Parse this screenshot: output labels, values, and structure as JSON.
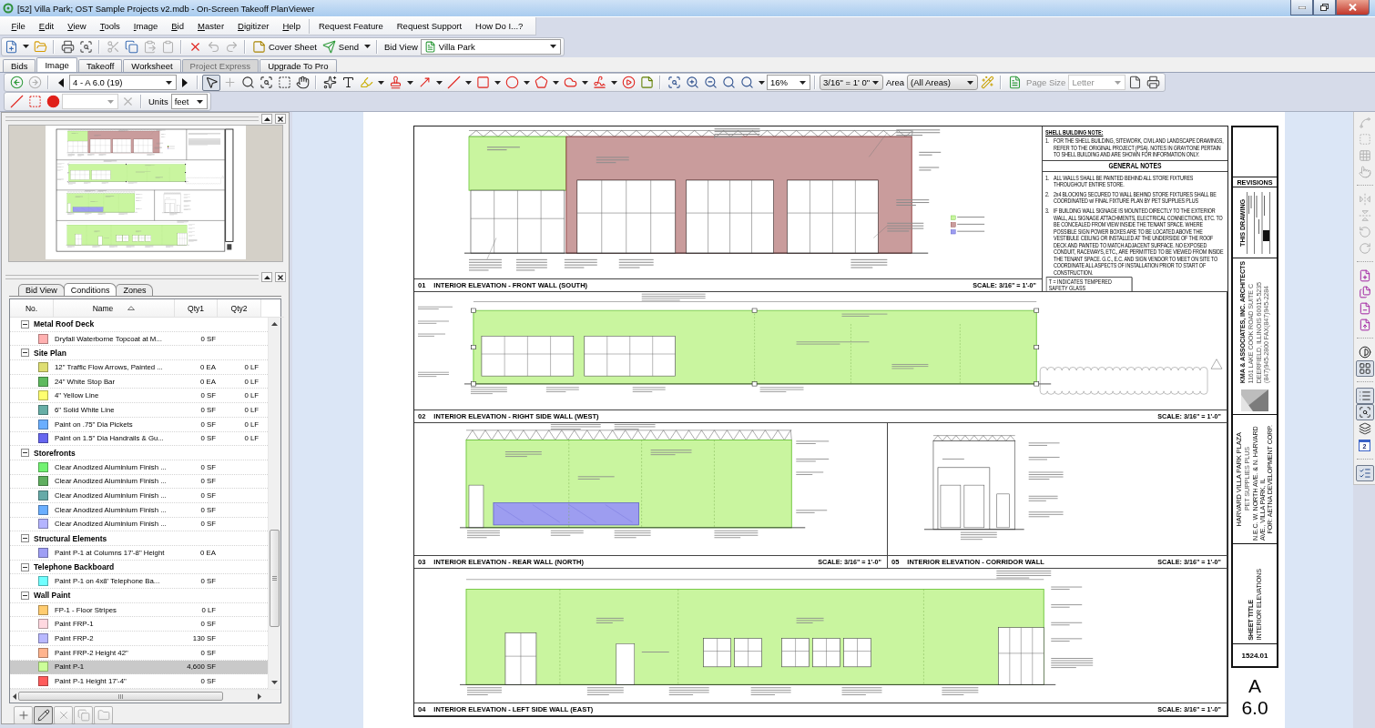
{
  "window": {
    "title": "[52] Villa Park; OST Sample Projects v2.mdb - On-Screen Takeoff PlanViewer"
  },
  "menu": [
    {
      "label": "File",
      "kind": "menu"
    },
    {
      "label": "Edit",
      "kind": "menu"
    },
    {
      "label": "View",
      "kind": "menu"
    },
    {
      "label": "Tools",
      "kind": "menu"
    },
    {
      "label": "Image",
      "kind": "menu"
    },
    {
      "label": "Bid",
      "kind": "menu"
    },
    {
      "label": "Master",
      "kind": "menu"
    },
    {
      "label": "Digitizer",
      "kind": "menu"
    },
    {
      "label": "Help",
      "kind": "menu"
    },
    {
      "label": "Request Feature",
      "kind": "link"
    },
    {
      "label": "Request Support",
      "kind": "link"
    },
    {
      "label": "How Do I...?",
      "kind": "link"
    }
  ],
  "toolbar": [
    {
      "kind": "new",
      "disabled": false
    },
    {
      "kind": "dropdown",
      "disabled": false
    },
    {
      "kind": "open",
      "disabled": false
    },
    {
      "kind": "separator"
    },
    {
      "kind": "print",
      "disabled": false
    },
    {
      "kind": "preview",
      "disabled": false
    },
    {
      "kind": "separator"
    },
    {
      "kind": "cut",
      "disabled": true
    },
    {
      "kind": "copy",
      "disabled": false
    },
    {
      "kind": "paste",
      "disabled": true
    },
    {
      "kind": "paste-special",
      "disabled": true
    },
    {
      "kind": "separator"
    },
    {
      "kind": "delete",
      "disabled": false
    },
    {
      "kind": "undo",
      "disabled": true
    },
    {
      "kind": "redo",
      "disabled": true
    },
    {
      "kind": "separator"
    },
    {
      "kind": "cover-sheet",
      "label": "Cover Sheet",
      "disabled": false
    },
    {
      "kind": "send",
      "label": "Send",
      "disabled": false
    },
    {
      "kind": "dropdown",
      "disabled": false
    },
    {
      "kind": "separator"
    },
    {
      "kind": "label",
      "label": "Bid View",
      "disabled": false
    },
    {
      "kind": "bid-combo",
      "value": "Villa Park",
      "disabled": false
    }
  ],
  "tabs": [
    {
      "label": "Bids",
      "selected": false,
      "disabled": false
    },
    {
      "label": "Image",
      "selected": true,
      "disabled": false
    },
    {
      "label": "Takeoff",
      "selected": false,
      "disabled": false
    },
    {
      "label": "Worksheet",
      "selected": false,
      "disabled": false
    },
    {
      "label": "Project Express",
      "selected": false,
      "disabled": true
    },
    {
      "label": "Upgrade To Pro",
      "selected": false,
      "disabled": false
    }
  ],
  "image_toolbar": [
    {
      "kind": "back",
      "disabled": false
    },
    {
      "kind": "forward",
      "disabled": true
    },
    {
      "kind": "separator"
    },
    {
      "kind": "prev",
      "disabled": false
    },
    {
      "kind": "page-combo",
      "value": "4 - A 6.0 (19)",
      "disabled": false
    },
    {
      "kind": "next",
      "disabled": false
    },
    {
      "kind": "separator"
    },
    {
      "kind": "select",
      "disabled": false,
      "pressed": true
    },
    {
      "kind": "crosshair",
      "disabled": true,
      "pressed": false
    },
    {
      "kind": "zoom",
      "disabled": false,
      "pressed": false
    },
    {
      "kind": "zoom-page",
      "disabled": false,
      "pressed": false
    },
    {
      "kind": "zoom-area",
      "disabled": false,
      "pressed": false
    },
    {
      "kind": "pan",
      "disabled": false,
      "pressed": false
    },
    {
      "kind": "separator"
    },
    {
      "kind": "magic",
      "disabled": false
    },
    {
      "kind": "text",
      "disabled": false
    },
    {
      "kind": "highlight",
      "disabled": false
    },
    {
      "kind": "dropdown",
      "disabled": false
    },
    {
      "kind": "stamp",
      "disabled": false
    },
    {
      "kind": "dropdown",
      "disabled": false
    },
    {
      "kind": "arrow",
      "disabled": false
    },
    {
      "kind": "dropdown",
      "disabled": false
    },
    {
      "kind": "line",
      "disabled": false
    },
    {
      "kind": "dropdown",
      "disabled": false
    },
    {
      "kind": "rect",
      "disabled": false
    },
    {
      "kind": "dropdown",
      "disabled": false
    },
    {
      "kind": "ellipse",
      "disabled": false
    },
    {
      "kind": "dropdown",
      "disabled": false
    },
    {
      "kind": "polygon",
      "disabled": false
    },
    {
      "kind": "dropdown",
      "disabled": false
    },
    {
      "kind": "cloud",
      "disabled": false
    },
    {
      "kind": "dropdown",
      "disabled": false
    },
    {
      "kind": "freehand",
      "disabled": false
    },
    {
      "kind": "dropdown",
      "disabled": false
    },
    {
      "kind": "audio",
      "disabled": false
    },
    {
      "kind": "note",
      "disabled": false
    },
    {
      "kind": "separator"
    },
    {
      "kind": "zoom-fit",
      "disabled": false
    },
    {
      "kind": "zoom-in",
      "disabled": false
    },
    {
      "kind": "zoom-out",
      "disabled": false
    },
    {
      "kind": "zoom-actual",
      "disabled": false
    },
    {
      "kind": "zoom-prev",
      "disabled": false
    },
    {
      "kind": "dropdown",
      "disabled": false
    },
    {
      "kind": "zoom-combo",
      "value": "16%",
      "disabled": false
    },
    {
      "kind": "separator"
    },
    {
      "kind": "scale-combo",
      "value": "3/16\" = 1' 0\"",
      "disabled": false
    },
    {
      "kind": "label",
      "label": "Area",
      "disabled": false
    },
    {
      "kind": "area-combo",
      "value": "(All Areas)",
      "disabled": false
    },
    {
      "kind": "wand",
      "disabled": false
    },
    {
      "kind": "separator"
    },
    {
      "kind": "page-setup",
      "disabled": false
    },
    {
      "kind": "label",
      "label": "Page Size",
      "disabled": true
    },
    {
      "kind": "paper-combo",
      "value": "Letter",
      "disabled": true
    },
    {
      "kind": "page",
      "disabled": false
    },
    {
      "kind": "print-page",
      "disabled": false
    }
  ],
  "measure_toolbar": [
    {
      "kind": "segment",
      "disabled": false
    },
    {
      "kind": "rect-select",
      "disabled": false
    },
    {
      "kind": "dot",
      "disabled": false
    },
    {
      "kind": "empty-combo",
      "disabled": true
    },
    {
      "kind": "clear",
      "disabled": true
    },
    {
      "kind": "separator"
    },
    {
      "kind": "label",
      "label": "Units",
      "disabled": false
    },
    {
      "kind": "units-combo",
      "value": "feet",
      "disabled": false
    }
  ],
  "panel": {
    "tabs": [
      {
        "label": "Bid View",
        "selected": false
      },
      {
        "label": "Conditions",
        "selected": true
      },
      {
        "label": "Zones",
        "selected": false
      }
    ],
    "columns": [
      {
        "label": "No.",
        "sorted": false
      },
      {
        "label": "Name",
        "sorted": true
      },
      {
        "label": "Qty1",
        "sorted": false
      },
      {
        "label": "Qty2",
        "sorted": false
      }
    ],
    "groups": [
      {
        "name": "Metal Roof Deck",
        "expanded": true,
        "children": [
          {
            "name": "Dryfall Waterborne Topcoat at M...",
            "color": "#ffb0b0",
            "qty1": "0 SF",
            "selected": false
          }
        ]
      },
      {
        "name": "Site Plan",
        "expanded": true,
        "children": [
          {
            "name": "12\" Traffic Flow Arrows, Painted ...",
            "color": "#dede72",
            "qty1": "0 EA",
            "qty2": "0 LF",
            "selected": false
          },
          {
            "name": "24\" White Stop Bar",
            "color": "#5fba5f",
            "qty1": "0 EA",
            "qty2": "0 LF",
            "selected": false
          },
          {
            "name": "4\" Yellow Line",
            "color": "#ffff70",
            "qty1": "0 SF",
            "qty2": "0 LF",
            "selected": false
          },
          {
            "name": "6\" Solid White Line",
            "color": "#66aea6",
            "qty1": "0 SF",
            "qty2": "0 LF",
            "selected": false
          },
          {
            "name": "Paint on .75\" Dia Pickets",
            "color": "#6aaeff",
            "qty1": "0 SF",
            "qty2": "0 LF",
            "selected": false
          },
          {
            "name": "Paint on 1.5\" Dia Handrails & Gu...",
            "color": "#6666f0",
            "qty1": "0 SF",
            "qty2": "0 LF",
            "selected": false
          }
        ]
      },
      {
        "name": "Storefronts",
        "expanded": true,
        "children": [
          {
            "name": "Clear Anodized Aluminium Finish ...",
            "color": "#72f272",
            "qty1": "0 SF",
            "selected": false
          },
          {
            "name": "Clear Anodized Aluminium Finish ...",
            "color": "#5fae5f",
            "qty1": "0 SF",
            "selected": false
          },
          {
            "name": "Clear Anodized Aluminium Finish ...",
            "color": "#66aaa8",
            "qty1": "0 SF",
            "selected": false
          },
          {
            "name": "Clear Anodized Aluminium Finish ...",
            "color": "#6aaeff",
            "qty1": "0 SF",
            "selected": false
          },
          {
            "name": "Clear Anodized Aluminium Finish ...",
            "color": "#b4b4ff",
            "qty1": "0 SF",
            "selected": false
          }
        ]
      },
      {
        "name": "Structural Elements",
        "expanded": true,
        "children": [
          {
            "name": "Paint P-1 at Columns 17'-8\" Height",
            "color": "#9f9ff5",
            "qty1": "0 EA",
            "selected": false
          }
        ]
      },
      {
        "name": "Telephone Backboard",
        "expanded": true,
        "children": [
          {
            "name": "Paint P-1 on 4x8' Telephone Ba...",
            "color": "#70ffff",
            "qty1": "0 SF",
            "selected": false
          }
        ]
      },
      {
        "name": "Wall Paint",
        "expanded": true,
        "children": [
          {
            "name": "FP-1 - Floor Stripes",
            "color": "#ffcc70",
            "qty1": "0 LF",
            "selected": false
          },
          {
            "name": "Paint FRP-1",
            "color": "#ffd8e0",
            "qty1": "0 SF",
            "selected": false
          },
          {
            "name": "Paint FRP-2",
            "color": "#b8b8ff",
            "qty1": "130 SF",
            "selected": false
          },
          {
            "name": "Paint FRP-2 Height 42\"",
            "color": "#ffb48e",
            "qty1": "0 SF",
            "selected": false
          },
          {
            "name": "Paint P-1",
            "color": "#ccff99",
            "qty1": "4,600 SF",
            "selected": true
          },
          {
            "name": "Paint P-1 Height 17'-4\"",
            "color": "#ff5c5c",
            "qty1": "0 SF",
            "selected": false
          }
        ]
      }
    ],
    "buttons": [
      {
        "kind": "add",
        "disabled": false,
        "pressed": false
      },
      {
        "kind": "edit",
        "disabled": false,
        "pressed": true
      },
      {
        "kind": "remove",
        "disabled": true,
        "pressed": false
      },
      {
        "kind": "duplicate",
        "disabled": true,
        "pressed": false
      },
      {
        "kind": "folder",
        "disabled": true,
        "pressed": false
      }
    ]
  },
  "sheet": {
    "panels": [
      {
        "kind": "front",
        "number": "01",
        "title": "INTERIOR ELEVATION - FRONT WALL (SOUTH)",
        "scale": "SCALE: 3/16\" = 1'-0\""
      },
      {
        "kind": "right",
        "number": "02",
        "title": "INTERIOR ELEVATION - RIGHT SIDE WALL (WEST)",
        "scale": "SCALE: 3/16\" = 1'-0\""
      },
      {
        "kind": "rear",
        "number": "03",
        "title": "INTERIOR ELEVATION - REAR WALL (NORTH)",
        "scale": "SCALE: 3/16\" = 1'-0\""
      },
      {
        "kind": "corridor",
        "number": "05",
        "title": "INTERIOR ELEVATION - CORRIDOR WALL",
        "scale": "SCALE: 3/16\" = 1'-0\""
      },
      {
        "kind": "left",
        "number": "04",
        "title": "INTERIOR ELEVATION - LEFT SIDE WALL (EAST)",
        "scale": "SCALE: 3/16\" = 1'-0\""
      }
    ],
    "shell_note": {
      "heading": "SHELL BUILDING NOTE:",
      "number": "1.",
      "text": "FOR THE SHELL BUILDING, SITEWORK, CIVIL AND LANDSCAPE DRAWINGS, REFER TO THE ORIGINAL PROJECT (PSA). NOTES IN GRAYTONE PERTAIN TO SHELL BUILDING AND ARE SHOWN FOR INFORMATION ONLY."
    },
    "general_notes": {
      "heading": "GENERAL NOTES",
      "items": [
        {
          "number": "1.",
          "text": "ALL WALLS SHALL BE PAINTED BEHIND ALL STORE FIXTURES THROUGHOUT ENTIRE STORE."
        },
        {
          "number": "2.",
          "text": "2x4 BLOCKING SECURED TO WALL BEHIND STORE FIXTURES SHALL BE COORDINATED w/ FINAL FIXTURE PLAN BY PET SUPPLIES PLUS"
        },
        {
          "number": "3.",
          "text": "IF BUILDING WALL SIGNAGE IS MOUNTED DIRECTLY TO THE EXTERIOR WALL, ALL SIGNAGE ATTACHMENTS, ELECTRICAL CONNECTIONS, ETC. TO BE CONCEALED FROM VIEW INSIDE THE TENANT SPACE. WHERE POSSIBLE SIGN POWER BOXES ARE TO BE LOCATED ABOVE THE VESTIBULE CEILING OR INSTALLED AT THE UNDERSIDE OF THE ROOF DECK AND PAINTED TO MATCH ADJACENT SURFACE. NO EXPOSED CONDUIT, RACEWAYS, ETC., ARE PERMITTED TO BE VIEWED FROM INSIDE THE TENANT SPACE. G.C., E.C. AND SIGN VENDOR TO MEET ON SITE TO COORDINATE ALL ASPECTS OF INSTALLATION PRIOR TO START OF CONSTRUCTION."
        }
      ]
    },
    "glass_key": "T = INDICATES TEMPERED SAFETY GLASS",
    "title_block": {
      "revisions": "REVISIONS",
      "drawing_status": "THIS DRAWING",
      "architect": "KMA & ASSOCIATES, INC. ARCHITECTS",
      "address": [
        "1161 LAKE COOK ROAD SUITE C",
        "DEERFIELD, ILLINOIS 60015-5235",
        "(847)945-2800 FAX(847)945-2284"
      ],
      "project": "HARVARD VILLA PARK PLAZA",
      "tenant": "PET SUPPLIES PLUS",
      "location": "N.E.C. W. NORTH AVE. & N. HARVARD AVE., VILLA PARK, IL",
      "client": "FOR: AETNA DEVELOPMENT CORP.",
      "sheet_title_label": "SHEET TITLE",
      "sheet_title": "INTERIOR ELEVATIONS",
      "job_number": "1524.01",
      "sheet_letter": "A",
      "sheet_number": "6.0"
    }
  },
  "side_toolbar": [
    {
      "kind": "path",
      "disabled": true,
      "pressed": false
    },
    {
      "kind": "frame",
      "disabled": true,
      "pressed": false
    },
    {
      "kind": "grid",
      "disabled": true,
      "pressed": false
    },
    {
      "kind": "pick",
      "disabled": true,
      "pressed": false
    },
    {
      "kind": "separator"
    },
    {
      "kind": "flip-h",
      "disabled": true,
      "pressed": false
    },
    {
      "kind": "flip-v",
      "disabled": true,
      "pressed": false
    },
    {
      "kind": "rotate-left",
      "disabled": true,
      "pressed": false
    },
    {
      "kind": "rotate-right",
      "disabled": true,
      "pressed": false
    },
    {
      "kind": "separator"
    },
    {
      "kind": "page-add",
      "disabled": false,
      "pressed": false
    },
    {
      "kind": "pages",
      "disabled": false,
      "pressed": false
    },
    {
      "kind": "page-minus",
      "disabled": false,
      "pressed": false
    },
    {
      "kind": "page-up",
      "disabled": false,
      "pressed": false
    },
    {
      "kind": "separator"
    },
    {
      "kind": "contrast",
      "disabled": false,
      "pressed": false
    },
    {
      "kind": "layout",
      "disabled": false,
      "pressed": true
    },
    {
      "kind": "separator"
    },
    {
      "kind": "list",
      "disabled": false,
      "pressed": true
    },
    {
      "kind": "zoom-window",
      "disabled": false,
      "pressed": true
    },
    {
      "kind": "layers",
      "disabled": false,
      "pressed": false
    },
    {
      "kind": "page-number",
      "label": "2",
      "disabled": false,
      "pressed": false
    },
    {
      "kind": "separator"
    },
    {
      "kind": "legend",
      "disabled": false,
      "pressed": true
    }
  ]
}
